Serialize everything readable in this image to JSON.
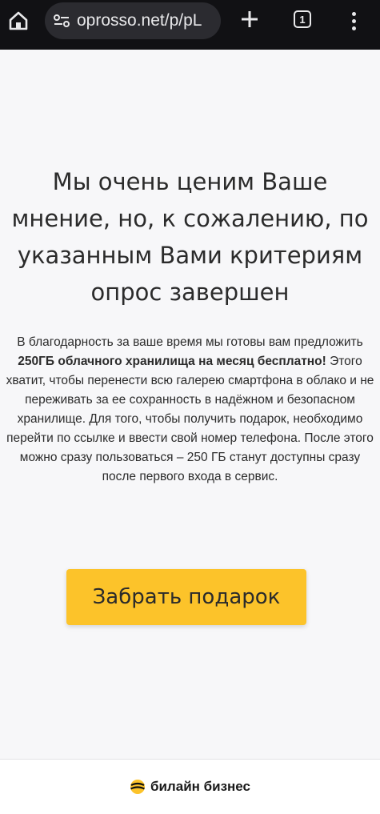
{
  "browser": {
    "url": "oprosso.net/p/pL",
    "tab_count": "1"
  },
  "main": {
    "heading": "Мы очень ценим Ваше мнение, но, к сожалению, по указанным Вами критериям опрос завершен",
    "body_part1": "В благодарность за ваше время мы готовы вам предложить ",
    "body_bold": "250ГБ облачного хранилища на месяц бесплатно!",
    "body_part2": " Этого хватит, чтобы перенести всю галерею смартфона в облако и не переживать за ее сохранность в надёжном и безопасном хранилище. Для того, чтобы получить подарок, необходимо перейти по ссылке и ввести свой номер телефона. После этого можно сразу пользоваться – 250 ГБ станут доступны сразу после первого входа в сервис.",
    "cta_label": "Забрать подарок"
  },
  "footer": {
    "brand": "билайн бизнес"
  },
  "colors": {
    "accent": "#fcc32a",
    "toolbar": "#111114"
  },
  "icons": [
    "home-icon",
    "site-info-icon",
    "plus-icon",
    "tab-switcher-icon",
    "more-icon",
    "beeline-logo-icon"
  ]
}
